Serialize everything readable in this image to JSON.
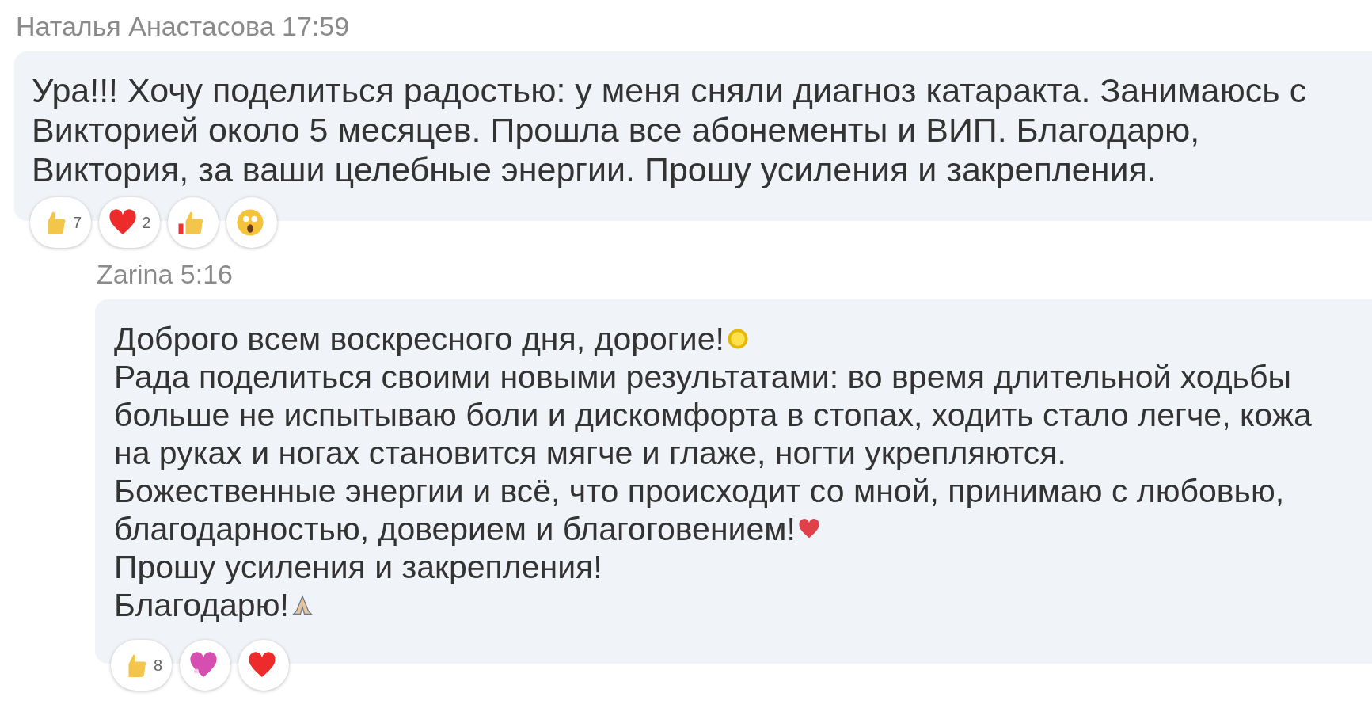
{
  "messages": [
    {
      "author": "Наталья Анастасова",
      "time": "17:59",
      "reply": false,
      "lines": [
        {
          "text": "Ура!!! Хочу поделиться радостью: у меня сняли диагноз катаракта. Занимаюсь с"
        },
        {
          "text": "Викторией около 5 месяцев. Прошла все абонементы и ВИП. Благодарю,"
        },
        {
          "text": "Виктория, за ваши целебные энергии. Прошу усиления и закрепления."
        }
      ],
      "reactions": [
        {
          "kind": "thumbs",
          "count": "7"
        },
        {
          "kind": "heart",
          "count": "2"
        },
        {
          "kind": "thumbs-flag"
        },
        {
          "kind": "shocked"
        }
      ]
    },
    {
      "author": "Zarina",
      "time": "5:16",
      "reply": true,
      "lines": [
        {
          "text": "Доброго всем воскресного дня, дорогие!",
          "kind": "sun"
        },
        {
          "text": "Рада поделиться своими новыми  результатами: во время длительной ходьбы"
        },
        {
          "text": "больше не испытываю боли и дискомфорта в стопах, ходить стало легче, кожа"
        },
        {
          "text": "на руках и ногах становится мягче и глаже, ногти укрепляются."
        },
        {
          "text": "Божественные энергии и всё, что происходит со мной, принимаю с любовью,"
        },
        {
          "text": "благодарностью, доверием и благоговением!",
          "kind": "heart"
        },
        {
          "text": "Прошу усиления и закрепления!"
        },
        {
          "text": "Благодарю!",
          "kind": "pray"
        }
      ],
      "reactions": [
        {
          "kind": "thumbs",
          "count": "8"
        },
        {
          "kind": "sparkle-heart"
        },
        {
          "kind": "heart"
        }
      ]
    }
  ]
}
